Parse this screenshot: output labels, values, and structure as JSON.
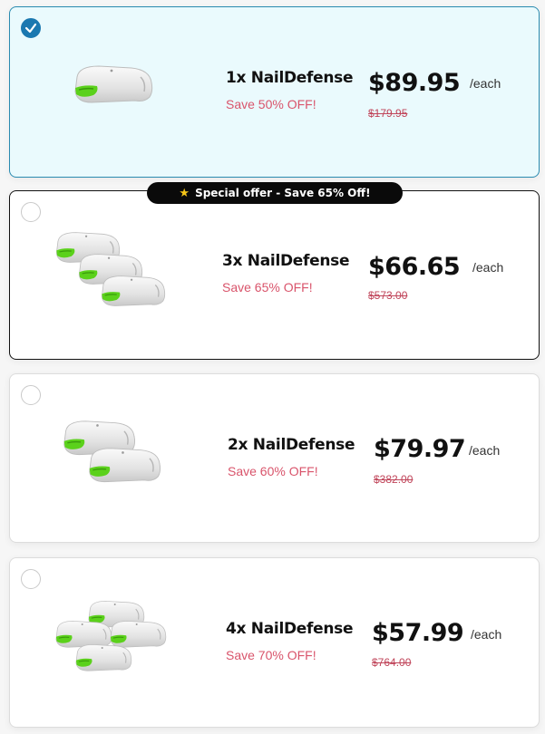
{
  "offers": [
    {
      "name": "1x NailDefense",
      "save": "Save 50% OFF!",
      "price": "$89.95",
      "per": "/each",
      "original": "$179.95",
      "selected": true
    },
    {
      "name": "3x NailDefense",
      "save": "Save 65% OFF!",
      "price": "$66.65",
      "per": "/each",
      "original": "$573.00",
      "badge": "Special offer - Save 65% Off!",
      "selected": false
    },
    {
      "name": "2x NailDefense",
      "save": "Save 60% OFF!",
      "price": "$79.97",
      "per": "/each",
      "original": "$382.00",
      "selected": false
    },
    {
      "name": "4x NailDefense",
      "save": "Save 70% OFF!",
      "price": "$57.99",
      "per": "/each",
      "original": "$764.00",
      "selected": false
    }
  ],
  "icons": {
    "badge": "star-icon",
    "selected": "checkmark-icon",
    "product": "nail-device-image"
  },
  "colors": {
    "selected_bg": "#eafafd",
    "selected_border": "#2a8bb0",
    "check_blue": "#1b78b0",
    "save_red": "#d9546b",
    "device_green": "#5bd11b"
  }
}
